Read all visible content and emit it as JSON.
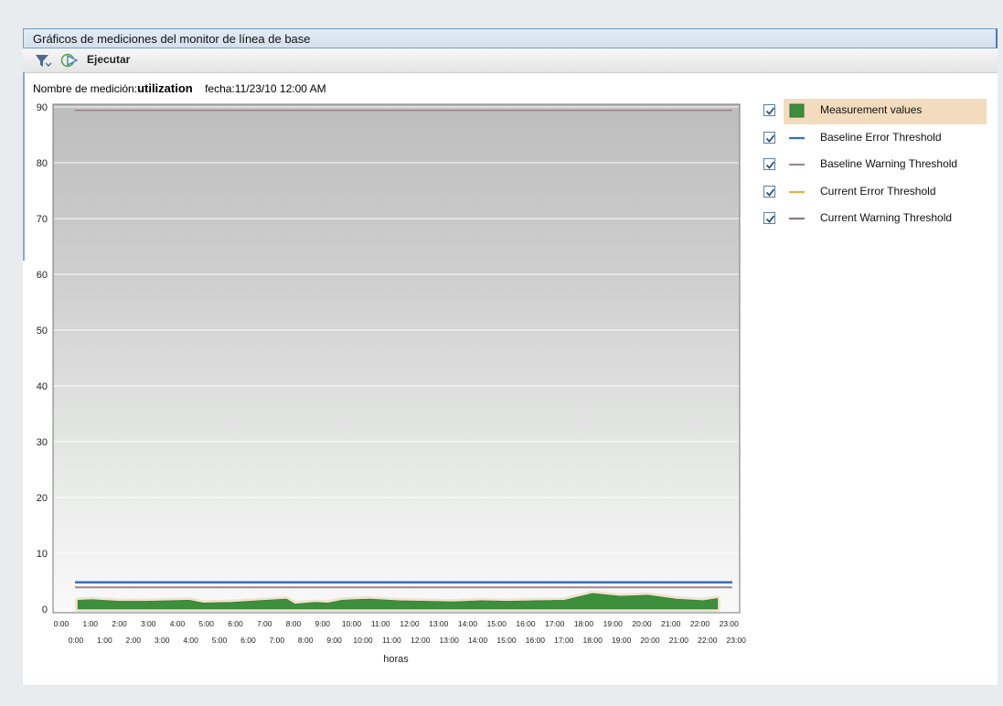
{
  "window": {
    "title": "Gráficos de mediciones del monitor de línea de base"
  },
  "toolbar": {
    "filter_icon": "filter-icon",
    "run_icon": "run-icon",
    "run_label": "Ejecutar"
  },
  "info": {
    "name_label": "Nombre de medición:",
    "name_value": "utilization",
    "date_label": "fecha:",
    "date_value": "11/23/10 12:00 AM"
  },
  "legend": {
    "items": [
      {
        "label": "Measurement values",
        "checked": true,
        "color": "#3d8f3d",
        "symbol": "box",
        "selected": true
      },
      {
        "label": "Baseline Error Threshold",
        "checked": true,
        "color": "#3c6fb0",
        "symbol": "line",
        "selected": false
      },
      {
        "label": "Baseline Warning Threshold",
        "checked": true,
        "color": "#9b8a96",
        "symbol": "line",
        "selected": false
      },
      {
        "label": "Current Error Threshold",
        "checked": true,
        "color": "#e8b040",
        "symbol": "line",
        "selected": false
      },
      {
        "label": "Current Warning Threshold",
        "checked": true,
        "color": "#8c7c84",
        "symbol": "line",
        "selected": false
      }
    ]
  },
  "chart_data": {
    "type": "area",
    "title": "",
    "xlabel": "horas",
    "ylabel": "",
    "ylim": [
      0,
      90
    ],
    "yticks": [
      0,
      10,
      20,
      30,
      40,
      50,
      60,
      70,
      80,
      90
    ],
    "grid": true,
    "legend_position": "right",
    "x_ticks_row1": [
      "0:00",
      "1:00",
      "2:00",
      "3:00",
      "4:00",
      "5:00",
      "6:00",
      "7:00",
      "8:00",
      "9:00",
      "10:00",
      "11:00",
      "12:00",
      "13:00",
      "14:00",
      "15:00",
      "16:00",
      "17:00",
      "18:00",
      "19:00",
      "20:00",
      "21:00",
      "22:00",
      "23:00"
    ],
    "x_ticks_row2": [
      "0:00",
      "1:00",
      "2:00",
      "3:00",
      "4:00",
      "5:00",
      "6:00",
      "7:00",
      "8:00",
      "9:00",
      "10:00",
      "11:00",
      "12:00",
      "13:00",
      "14:00",
      "15:00",
      "16:00",
      "17:00",
      "18:00",
      "19:00",
      "20:00",
      "21:00",
      "22:00",
      "23:00"
    ],
    "x": [
      0.5,
      1,
      2,
      3,
      3.8,
      4.5,
      5,
      6,
      7,
      8,
      8.3,
      9,
      9.5,
      10,
      11,
      12,
      13,
      14,
      15,
      16,
      17,
      18,
      19,
      20,
      21,
      22,
      23,
      23.5
    ],
    "series": [
      {
        "name": "Measurement values",
        "color": "#3d8f3d",
        "values": [
          1.6,
          1.7,
          1.4,
          1.4,
          1.5,
          1.6,
          1.1,
          1.2,
          1.5,
          1.8,
          0.9,
          1.2,
          1.1,
          1.6,
          1.8,
          1.5,
          1.4,
          1.3,
          1.5,
          1.4,
          1.5,
          1.6,
          2.8,
          2.3,
          2.5,
          1.8,
          1.5,
          1.9
        ]
      },
      {
        "name": "Baseline Error Threshold",
        "color": "#3c6fb0",
        "values": [
          4.8
        ]
      },
      {
        "name": "Baseline Warning Threshold",
        "color": "#9b8a96",
        "values": [
          3.9
        ]
      },
      {
        "name": "Current Error Threshold",
        "color": "#e8b040",
        "values": [
          89.4
        ]
      },
      {
        "name": "Current Warning Threshold",
        "color": "#8c7c84",
        "values": [
          89.4
        ]
      }
    ]
  }
}
